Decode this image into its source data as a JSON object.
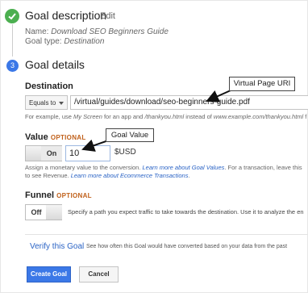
{
  "goal_description": {
    "title": "Goal description",
    "edit_label": "Edit",
    "name_prefix": "Name:",
    "name_value": "Download SEO Beginners Guide",
    "type_prefix": "Goal type:",
    "type_value": "Destination"
  },
  "goal_details": {
    "step_number": "3",
    "title": "Goal details"
  },
  "destination": {
    "label": "Destination",
    "match_type": "Equals to",
    "url_value": "/virtual/guides/download/seo-beginners-guide.pdf",
    "hint_prefix": "For example, use ",
    "hint_example1": "My Screen",
    "hint_mid": " for an app and ",
    "hint_example2": "/thankyou.html",
    "hint_mid2": " instead of ",
    "hint_example3": "www.example.com/thankyou.html",
    "hint_end": " f"
  },
  "value": {
    "label": "Value",
    "optional": "OPTIONAL",
    "toggle_label": "On",
    "amount": "10",
    "currency": "$USD",
    "hint1_start": "Assign a monetary value to the conversion. ",
    "hint1_link": "Learn more about Goal Values",
    "hint1_end": ". For a transaction, leave this",
    "hint2_start": "to see Revenue. ",
    "hint2_link": "Learn more about Ecommerce Transactions",
    "hint2_end": "."
  },
  "funnel": {
    "label": "Funnel",
    "optional": "OPTIONAL",
    "toggle_label": "Off",
    "description": "Specify a path you expect traffic to take towards the destination. Use it to analyze the en"
  },
  "verify": {
    "link_label": "Verify this Goal",
    "description": "See how often this Goal would have converted based on your data from the past"
  },
  "buttons": {
    "create": "Create Goal",
    "cancel": "Cancel"
  },
  "callouts": {
    "virtual_page": "Virtual Page URI",
    "goal_value": "Goal Value"
  },
  "colors": {
    "accent": "#3b78e7",
    "complete": "#4caf50",
    "optional": "#c0601a",
    "link": "#2a63c5"
  }
}
